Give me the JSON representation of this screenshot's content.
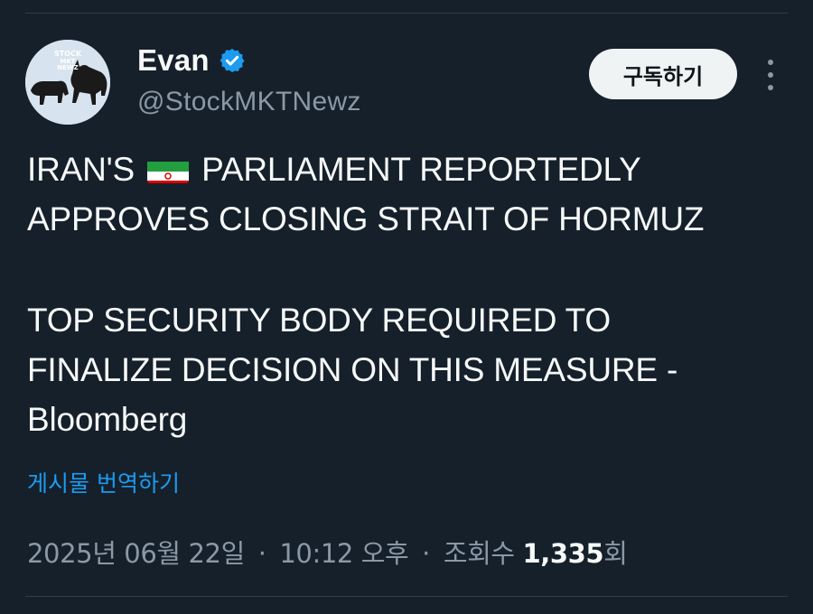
{
  "author": {
    "display_name": "Evan",
    "handle": "@StockMKTNewz",
    "verified": true,
    "avatar_text": [
      "STOCK",
      "MKT",
      "NEWZ"
    ]
  },
  "actions": {
    "subscribe_label": "구독하기",
    "more_icon": "more-options-icon"
  },
  "tweet": {
    "paragraph1": [
      "IRAN'S",
      "PARLIAMENT REPORTEDLY",
      "APPROVES CLOSING STRAIT OF HORMUZ"
    ],
    "paragraph2": [
      "TOP SECURITY BODY REQUIRED TO",
      "FINALIZE DECISION ON THIS MEASURE -",
      "Bloomberg"
    ],
    "flag_icon": "iran-flag-icon",
    "translate_label": "게시물 번역하기"
  },
  "meta": {
    "date": "2025년 06월 22일",
    "separator": "·",
    "time": "10:12 오후",
    "views_label": "조회수",
    "views_count": "1,335",
    "views_suffix": "회"
  },
  "colors": {
    "background": "#15202b",
    "text_primary": "#f7f9f9",
    "text_secondary": "#8b98a5",
    "link": "#1d9bf0",
    "verified": "#1d9bf0",
    "button_bg": "#eff3f4"
  }
}
